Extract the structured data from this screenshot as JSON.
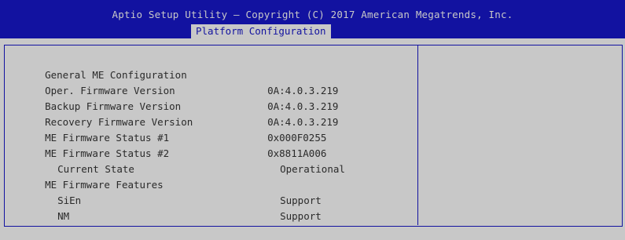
{
  "header": {
    "title": "Aptio Setup Utility – Copyright (C) 2017 American Megatrends, Inc.",
    "active_tab": "Platform Configuration"
  },
  "main": {
    "section_title": "General ME Configuration",
    "rows": [
      {
        "label": "Oper. Firmware Version",
        "value": "0A:4.0.3.219"
      },
      {
        "label": "Backup Firmware Version",
        "value": "0A:4.0.3.219"
      },
      {
        "label": "Recovery Firmware Version",
        "value": "0A:4.0.3.219"
      },
      {
        "label": "ME Firmware Status #1",
        "value": "0x000F0255"
      },
      {
        "label": "ME Firmware Status #2",
        "value": "0x8811A006"
      },
      {
        "label": "Current State",
        "value": "Operational"
      },
      {
        "label": "ME Firmware Features",
        "value": ""
      },
      {
        "label": "SiEn",
        "value": "Support"
      },
      {
        "label": "NM",
        "value": "Support"
      }
    ]
  }
}
